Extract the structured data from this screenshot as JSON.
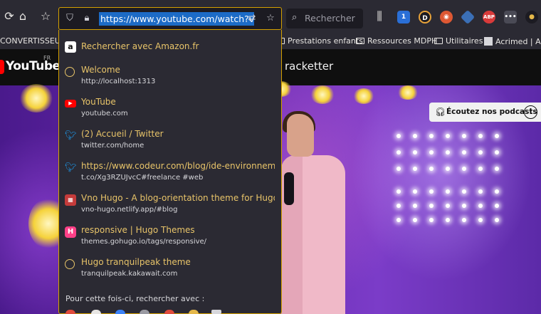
{
  "toolbar": {
    "url": "https://www.youtube.com/watch?v=RYj",
    "search_placeholder": "Rechercher",
    "badge_count": "1",
    "ext_abp": "ABP"
  },
  "bookmarks": {
    "items": [
      "CONVERTISSEUR",
      "Prestations enfants",
      "Ressources MDPH",
      "Utilitaires",
      "Acrimed | Acti"
    ]
  },
  "youtube": {
    "logo": "YouTube",
    "region": "FR",
    "query": "racketter",
    "podcast_label": "Écoutez nos podcasts",
    "info": "i"
  },
  "dropdown": {
    "items": [
      {
        "title": "Rechercher avec Amazon.fr",
        "subtitle": "",
        "icon": "amazon-icon"
      },
      {
        "title": "Welcome",
        "subtitle": "http://localhost:1313",
        "icon": "globe-icon"
      },
      {
        "title": "YouTube",
        "subtitle": "youtube.com",
        "icon": "youtube-icon"
      },
      {
        "title": "(2) Accueil / Twitter",
        "subtitle": "twitter.com/home",
        "icon": "twitter-icon"
      },
      {
        "title": "https://www.codeur.com/blog/ide-environnement-d",
        "subtitle": "t.co/Xg3RZUJvcC#freelance #web",
        "icon": "twitter-icon"
      },
      {
        "title": "Vno Hugo - A blog-orientation theme for Hugo",
        "subtitle": "vno-hugo.netlify.app/#blog",
        "icon": "vno-icon"
      },
      {
        "title": "responsive | Hugo Themes",
        "subtitle": "themes.gohugo.io/tags/responsive/",
        "icon": "hugo-icon"
      },
      {
        "title": "Hugo tranquilpeak theme",
        "subtitle": "tranquilpeak.kakawait.com",
        "icon": "globe-icon"
      }
    ],
    "footer": "Pour cette fois-ci, rechercher avec :"
  },
  "colors": {
    "accent": "#d4a000",
    "link_title": "#e8c469",
    "selection": "#1c6bc6",
    "youtube_red": "#ff0000"
  }
}
